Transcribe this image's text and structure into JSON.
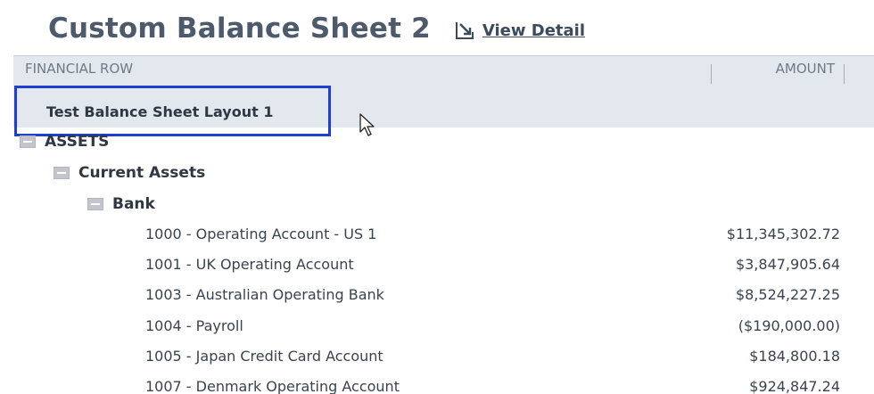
{
  "report": {
    "title": "Custom Balance Sheet 2",
    "view_detail_label": "View Detail",
    "view_detail_icon": "export-arrow-icon"
  },
  "columns": {
    "financial_row": "FINANCIAL ROW",
    "amount": "AMOUNT"
  },
  "layout_label": "Test Balance Sheet Layout 1",
  "tree": {
    "assets": "ASSETS",
    "current_assets": "Current Assets",
    "bank": "Bank"
  },
  "accounts": [
    {
      "name": "1000 - Operating Account - US 1",
      "amount": "$11,345,302.72"
    },
    {
      "name": "1001 - UK Operating Account",
      "amount": "$3,847,905.64"
    },
    {
      "name": "1003 - Australian Operating Bank",
      "amount": "$8,524,227.25"
    },
    {
      "name": "1004 - Payroll",
      "amount": "($190,000.00)"
    },
    {
      "name": "1005 - Japan Credit Card Account",
      "amount": "$184,800.18"
    },
    {
      "name": "1007 - Denmark Operating Account",
      "amount": "$924,847.24"
    }
  ],
  "colors": {
    "title": "#4d5a6c",
    "header_band": "#e3e8ee",
    "focus_outline": "#1f3fd1"
  }
}
